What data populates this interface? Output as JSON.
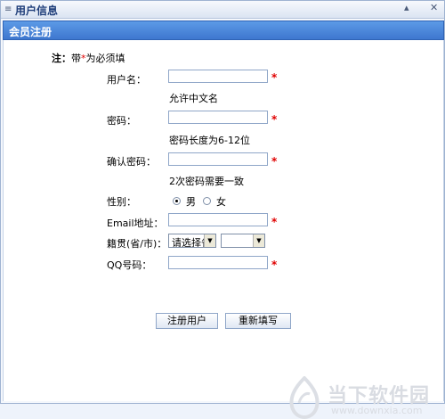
{
  "window": {
    "grip": "≡",
    "title": "用户信息",
    "ctrl_min": "▴",
    "ctrl_close": "✕"
  },
  "section": {
    "title": "会员注册"
  },
  "note": {
    "prefix": "注：",
    "text_a": "带",
    "star": "*",
    "text_b": "为必须填"
  },
  "fields": {
    "username_label": "用户名：",
    "username_value": "",
    "username_hint": "允许中文名",
    "password_label": "密码：",
    "password_value": "",
    "password_hint": "密码长度为6-12位",
    "confirm_label": "确认密码：",
    "confirm_value": "",
    "confirm_hint": "2次密码需要一致",
    "gender_label": "性别：",
    "gender_male": "男",
    "gender_female": "女",
    "gender_selected": "男",
    "email_label": "Email地址：",
    "email_value": "",
    "native_label": "籍贯(省/市)：",
    "province_value": "请选择省",
    "city_value": "",
    "qq_label": "QQ号码：",
    "qq_value": "",
    "required_star": "*"
  },
  "buttons": {
    "register": "注册用户",
    "reset": "重新填写"
  },
  "watermark": {
    "text": "当下软件园",
    "url": "www.downxia.com"
  }
}
